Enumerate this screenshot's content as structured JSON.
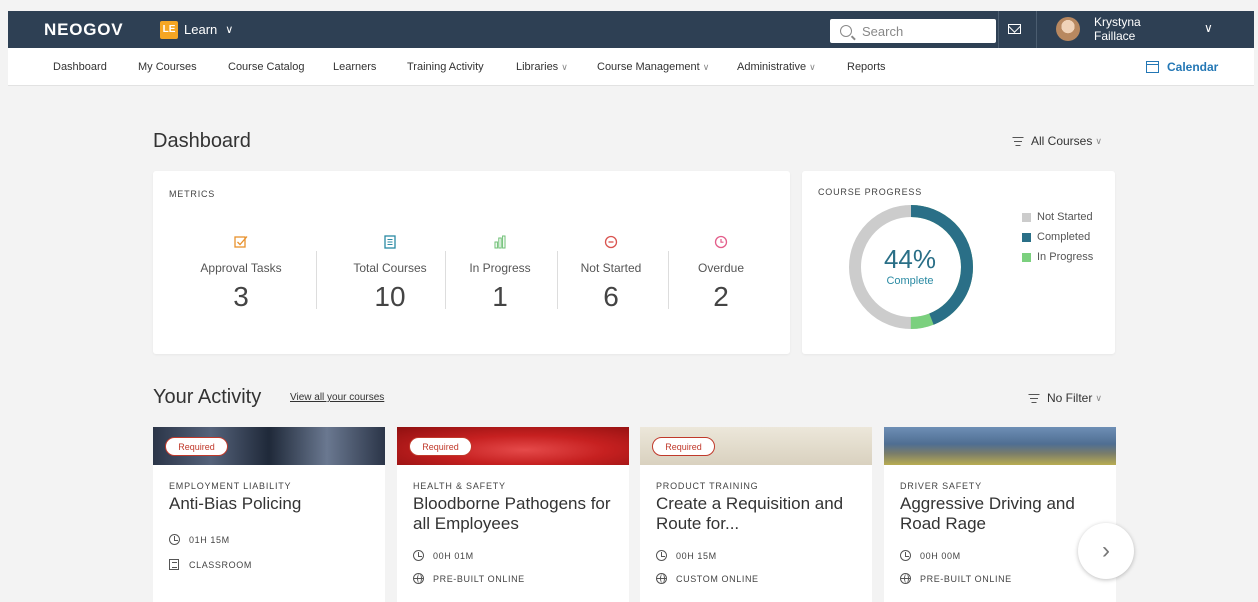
{
  "header": {
    "logo": "NEOGOV",
    "app_badge": "LE",
    "app_name": "Learn",
    "search_placeholder": "Search",
    "user_first": "Krystyna",
    "user_last": "Faillace"
  },
  "nav": {
    "items": [
      {
        "label": "Dashboard"
      },
      {
        "label": "My Courses"
      },
      {
        "label": "Course Catalog"
      },
      {
        "label": "Learners"
      },
      {
        "label": "Training Activity"
      },
      {
        "label": "Libraries"
      },
      {
        "label": "Course Management"
      },
      {
        "label": "Administrative"
      },
      {
        "label": "Reports"
      }
    ],
    "calendar": "Calendar"
  },
  "dashboard": {
    "title": "Dashboard",
    "filter": "All Courses",
    "metrics_label": "METRICS",
    "metrics": [
      {
        "label": "Approval Tasks",
        "value": "3",
        "icon": "checkbox-icon",
        "color": "#e8912d"
      },
      {
        "label": "Total Courses",
        "value": "10",
        "icon": "list-icon",
        "color": "#2a8aa3"
      },
      {
        "label": "In Progress",
        "value": "1",
        "icon": "bars-icon",
        "color": "#6cbf73"
      },
      {
        "label": "Not Started",
        "value": "6",
        "icon": "minus-circle-icon",
        "color": "#d9534f"
      },
      {
        "label": "Overdue",
        "value": "2",
        "icon": "clock-icon",
        "color": "#e35d8a"
      }
    ],
    "progress": {
      "label": "COURSE PROGRESS",
      "percent_text": "44%",
      "sub": "Complete",
      "completed": 0.44,
      "in_progress": 0.06,
      "legend": [
        {
          "label": "Not Started",
          "color": "#cccccc"
        },
        {
          "label": "Completed",
          "color": "#2a6f87"
        },
        {
          "label": "In Progress",
          "color": "#7bd07e"
        }
      ]
    }
  },
  "activity": {
    "title": "Your Activity",
    "link": "View all your courses",
    "filter": "No Filter",
    "courses": [
      {
        "required": "Required",
        "category": "EMPLOYMENT LIABILITY",
        "title": "Anti-Bias Policing",
        "duration": "01H 15M",
        "type": "CLASSROOM",
        "type_icon": "document-icon"
      },
      {
        "required": "Required",
        "category": "HEALTH & SAFETY",
        "title": "Bloodborne Pathogens for all Employees",
        "duration": "00H 01M",
        "type": "PRE-BUILT ONLINE",
        "type_icon": "globe-icon"
      },
      {
        "required": "Required",
        "category": "PRODUCT TRAINING",
        "title": "Create a Requisition and Route for...",
        "duration": "00H 15M",
        "type": "CUSTOM ONLINE",
        "type_icon": "globe-icon"
      },
      {
        "required": "",
        "category": "DRIVER SAFETY",
        "title": "Aggressive Driving and Road Rage",
        "duration": "00H 00M",
        "type": "PRE-BUILT ONLINE",
        "type_icon": "globe-icon"
      }
    ]
  }
}
